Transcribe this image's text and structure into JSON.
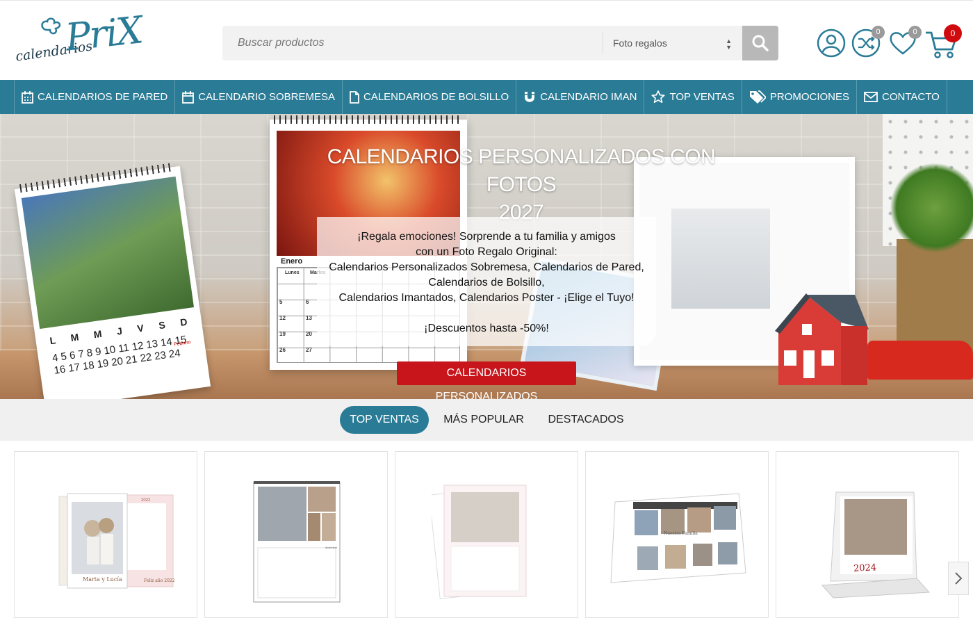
{
  "header": {
    "logo_small": "calendarios",
    "logo_big": "PriX",
    "search": {
      "placeholder": "Buscar productos",
      "category": "Foto regalos"
    },
    "compare_count": "0",
    "wishlist_count": "0",
    "cart_count": "0"
  },
  "nav": {
    "items": [
      {
        "label": "CALENDARIOS DE PARED",
        "icon": "calendar-grid-icon"
      },
      {
        "label": "CALENDARIO SOBREMESA",
        "icon": "calendar-icon"
      },
      {
        "label": "CALENDARIOS DE BOLSILLO",
        "icon": "document-icon"
      },
      {
        "label": "CALENDARIO IMAN",
        "icon": "magnet-icon"
      },
      {
        "label": "TOP VENTAS",
        "icon": "star-icon"
      },
      {
        "label": "PROMOCIONES",
        "icon": "tags-icon"
      },
      {
        "label": "CONTACTO",
        "icon": "envelope-icon"
      }
    ]
  },
  "hero": {
    "title_line1": "CALENDARIOS PERSONALIZADOS CON FOTOS",
    "title_line2": "2027",
    "text_lines": [
      "¡Regala emociones! Sorprende a tu familia y amigos",
      "con un Foto Regalo Original:",
      "Calendarios Personalizados Sobremesa, Calendarios de Pared,",
      "Calendarios de Bolsillo,",
      "Calendarios Imantados, Calendarios Poster - ¡Elige el Tuyo!"
    ],
    "discount": "¡Descuentos hasta -50%!",
    "cta": "CALENDARIOS PERSONALIZADOS",
    "mid_calendar": {
      "month": "Enero",
      "day_header_1": "Lunes",
      "day_header_2": "Martes",
      "row_numbers": [
        "5",
        "6",
        "12",
        "13",
        "19",
        "20",
        "26",
        "27"
      ]
    },
    "left_calendar": {
      "days": "L M M J V S D",
      "numbers": "4 5 6 7 8 9 10 11 12 13 14 15 16 17 18 19 20 21 22 23 24",
      "mini_month": "Febrero"
    }
  },
  "tabs": [
    {
      "label": "TOP VENTAS",
      "active": true
    },
    {
      "label": "MÁS POPULAR",
      "active": false
    },
    {
      "label": "DESTACADOS",
      "active": false
    }
  ],
  "products": [
    {
      "caption": "Marta y Lucía",
      "year_label": "2022",
      "subcaption": "Feliz año 2022"
    },
    {
      "caption": "",
      "month_label": "diciembre"
    },
    {
      "caption": ""
    },
    {
      "caption": "Nuestra Familia"
    },
    {
      "caption": "2024"
    }
  ],
  "colors": {
    "primary": "#2a7b96",
    "accent_red": "#c8141b",
    "badge_red": "#d10a10"
  }
}
